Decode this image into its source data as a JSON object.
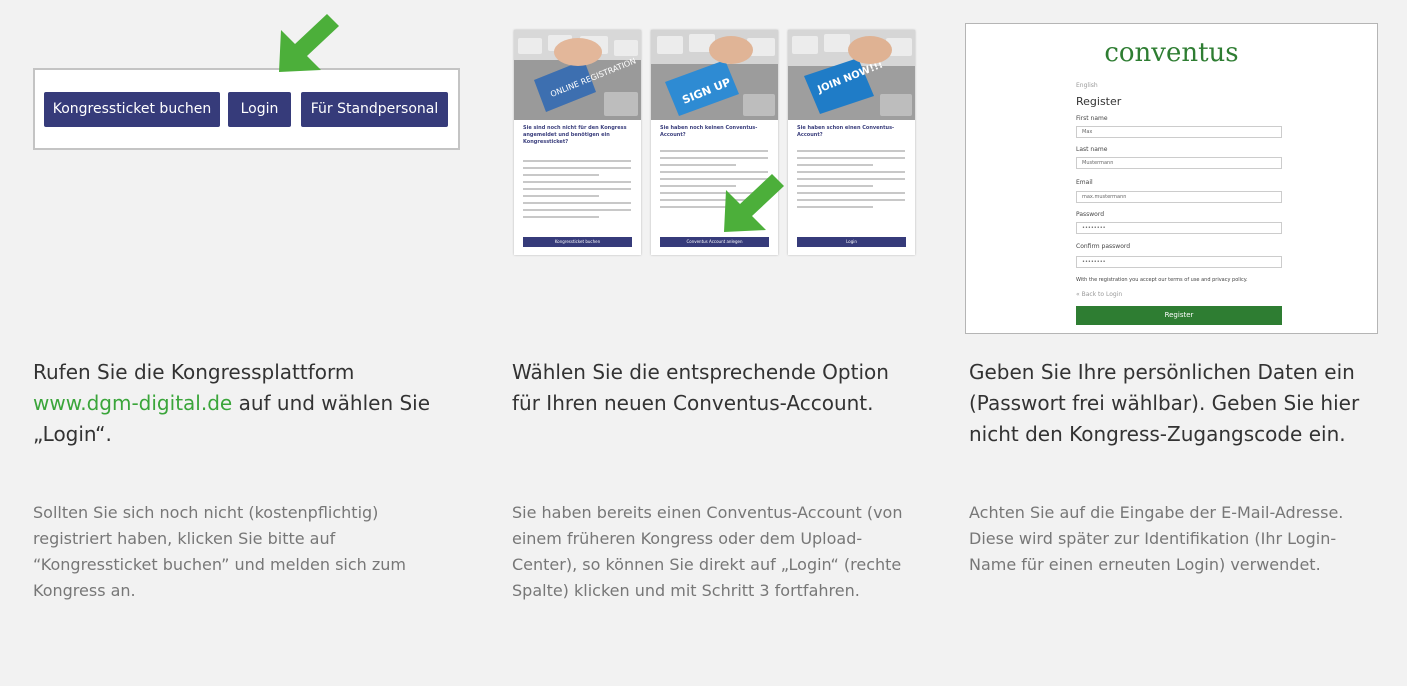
{
  "step1": {
    "buttons": [
      "Kongressticket buchen",
      "Login",
      "Für Standpersonal"
    ],
    "heading_pre": "Rufen Sie die Kongressplattform",
    "heading_link": "www.dgm-digital.de",
    "heading_post": "auf und wählen Sie „Login“.",
    "sub": "Sollten Sie sich noch nicht (kostenpflichtig) registriert haben, klicken Sie bitte auf “Kongressticket buchen” und melden sich zum Kongress an."
  },
  "step2": {
    "cards": [
      {
        "key_text": "ONLINE REGISTRATION",
        "title": "Sie sind noch nicht für den Kongress angemeldet und benötigen ein Kongressticket?",
        "button": "Kongressticket buchen",
        "key_color": "#3d6fb0"
      },
      {
        "key_text": "SIGN UP",
        "title": "Sie haben noch keinen Conventus-Account?",
        "button": "Conventus Account anlegen",
        "key_color": "#2e8bd3"
      },
      {
        "key_text": "JOIN NOW!!!",
        "title": "Sie haben schon einen Conventus-Account?",
        "button": "Login",
        "key_color": "#1f7cc7"
      }
    ],
    "heading": "Wählen Sie die entsprechende Option für Ihren neuen Conventus-Account.",
    "sub": "Sie haben bereits einen Conventus-Account (von einem früheren Kongress oder dem Upload-Center), so können Sie direkt auf „Login“ (rechte Spalte) klicken und mit Schritt 3 fortfahren."
  },
  "step3": {
    "brand": "conventus",
    "lang": "English",
    "title": "Register",
    "fields": [
      {
        "label": "First name",
        "value": "Max"
      },
      {
        "label": "Last name",
        "value": "Mustermann"
      },
      {
        "label": "Email",
        "value": "max.mustermann"
      },
      {
        "label": "Password",
        "value": "••••••••"
      },
      {
        "label": "Confirm password",
        "value": "••••••••"
      }
    ],
    "terms": "With the registration you accept our terms of use and privacy policy.",
    "back": "« Back to Login",
    "register_button": "Register",
    "heading": "Geben Sie Ihre persönlichen Daten ein (Passwort frei wählbar). Geben Sie hier nicht den Kongress-Zugangscode ein.",
    "sub": "Achten Sie auf die Eingabe der E-Mail-Adresse. Diese wird später zur Identifikation (Ihr Login-Name für einen erneuten Login) verwendet."
  },
  "colors": {
    "button_blue": "#363b7a",
    "arrow_green": "#4caf3a",
    "brand_green": "#2e7d32",
    "link_green": "#3aa53a"
  },
  "icons": [
    "green-arrow-icon",
    "keyboard-photo"
  ]
}
